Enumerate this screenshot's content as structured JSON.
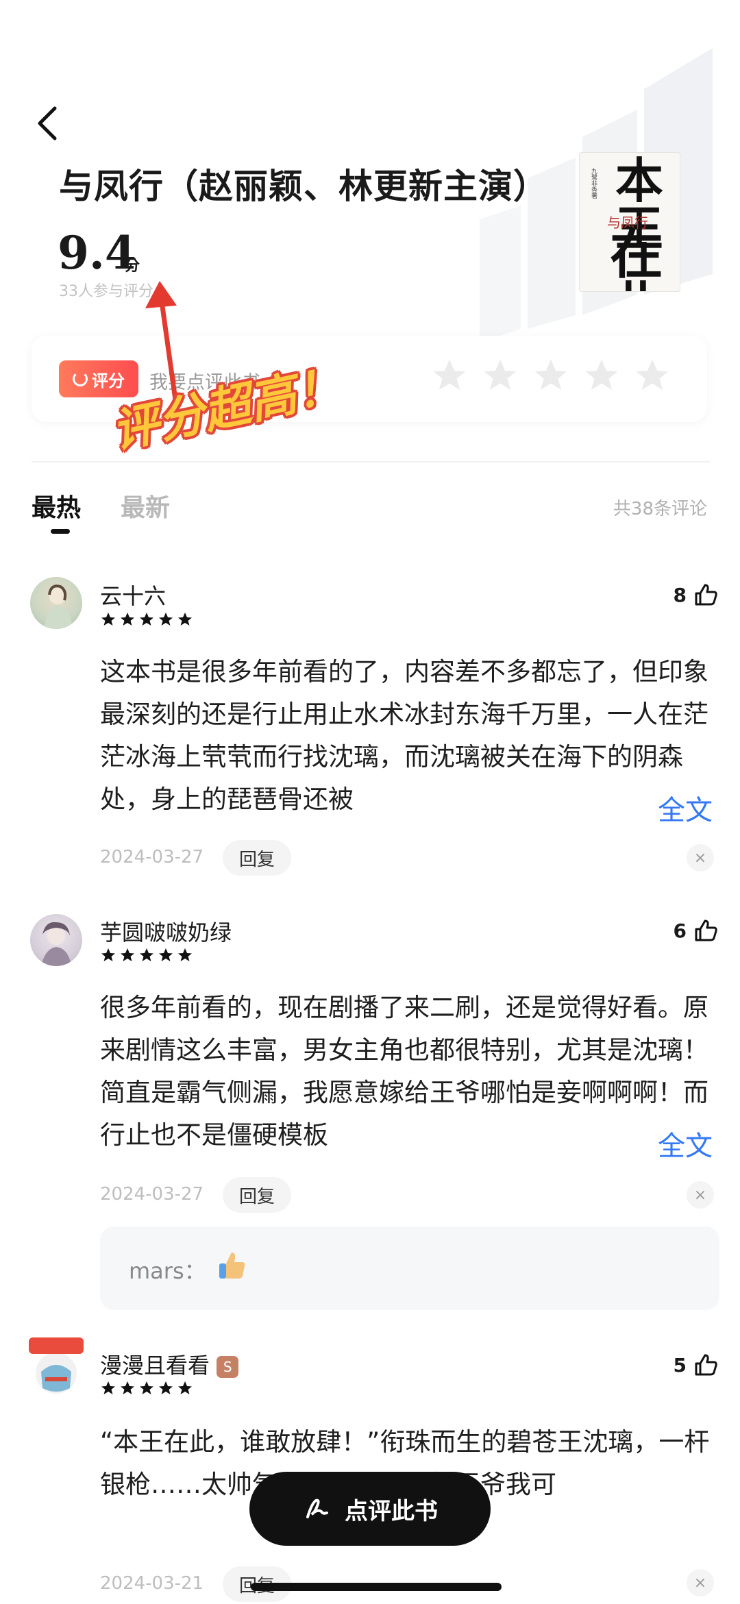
{
  "header": {
    "title": "与凤行（赵丽颖、林更新主演）",
    "score": "9.4",
    "score_unit": "分",
    "score_count": "33人参与评分",
    "cover_text_top": "本王",
    "cover_text_bottom": "在此",
    "cover_subtitle": "与凤行",
    "cover_small": "九鹭非香著"
  },
  "rating_card": {
    "badge_label": "评分",
    "prompt": "我要点评此书"
  },
  "annotation": {
    "text": "评分超高！"
  },
  "tabs": [
    {
      "label": "最热",
      "active": true
    },
    {
      "label": "最新",
      "active": false
    }
  ],
  "total_comments": "共38条评论",
  "comments": [
    {
      "name": "云十六",
      "likes": "8",
      "text": "这本书是很多年前看的了，内容差不多都忘了，但印象最深刻的还是行止用止水术冰封东海千万里，一人在茫茫冰海上茕茕而行找沈璃，而沈璃被关在海下的阴森处，身上的琵琶骨还被",
      "more": "全文",
      "date": "2024-03-27",
      "reply_label": "回复"
    },
    {
      "name": "芋圆啵啵奶绿",
      "likes": "6",
      "text": "很多年前看的，现在剧播了来二刷，还是觉得好看。原来剧情这么丰富，男女主角也都很特别，尤其是沈璃！简直是霸气侧漏，我愿意嫁给王爷哪怕是妾啊啊啊！而行止也不是僵硬模板",
      "more": "全文",
      "date": "2024-03-27",
      "reply_label": "回复",
      "sub_reply": {
        "name": "mars："
      }
    },
    {
      "name": "漫漫且看看",
      "likes": "5",
      "text": "“本王在此，谁敢放肆！”衔珠而生的碧苍王沈璃，一杆银枪……太帅气了啊啊啊，霸气王爷我可",
      "date": "2024-03-21",
      "reply_label": "回复"
    }
  ],
  "fab": {
    "label": "点评此书"
  },
  "colors": {
    "accent_blue": "#3478f6",
    "badge_red": "#ff4d4f",
    "annotation_yellow": "#ffc83a"
  }
}
